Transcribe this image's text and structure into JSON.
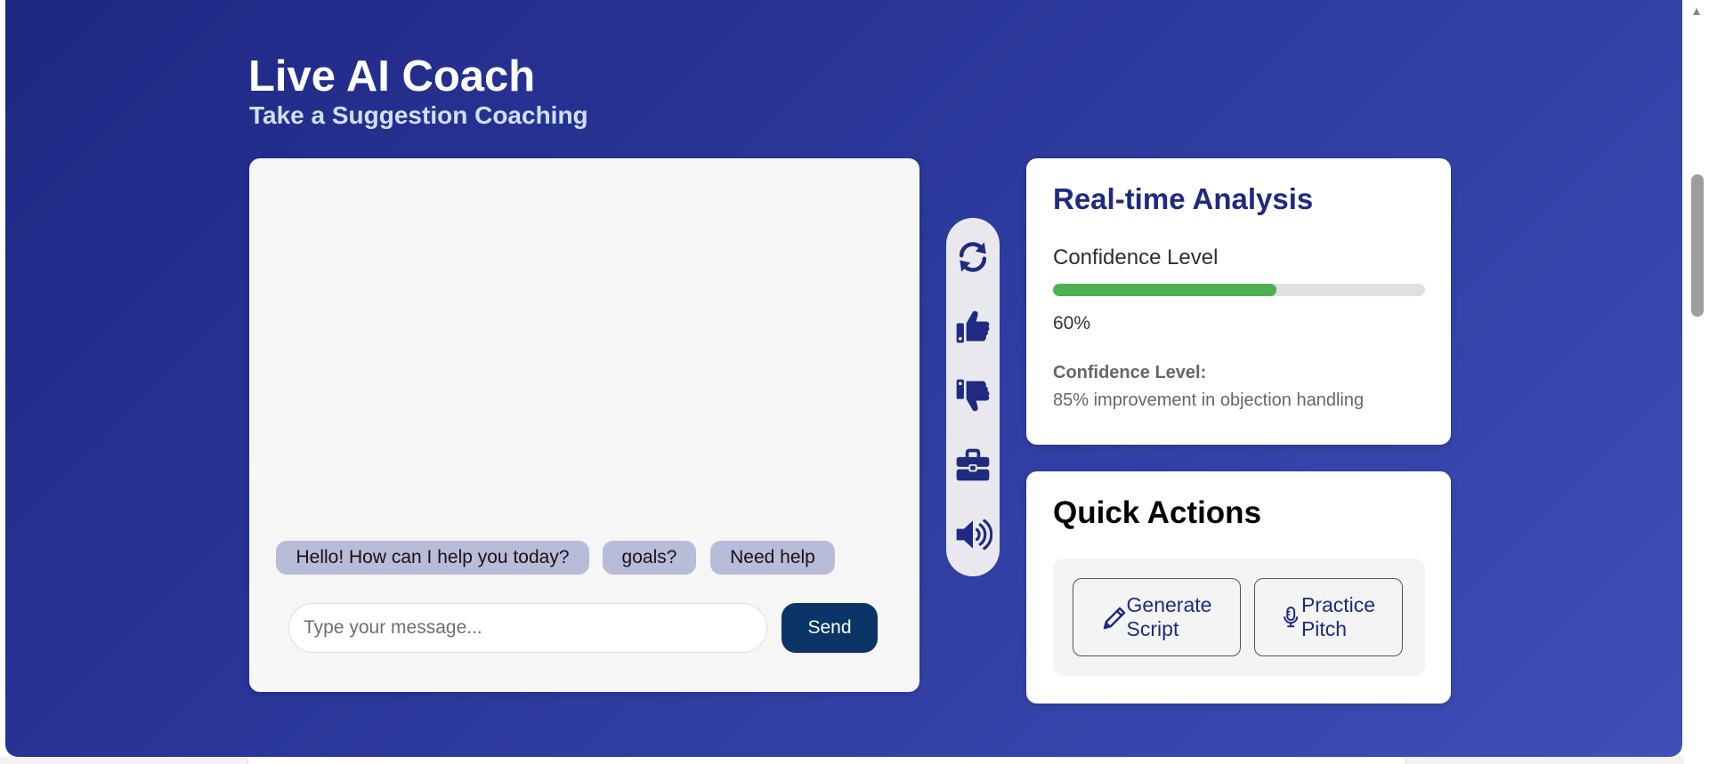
{
  "header": {
    "title": "Live AI Coach",
    "subtitle": "Take a Suggestion Coaching"
  },
  "chat": {
    "suggestions": [
      "Hello! How can I help you today?",
      "goals?",
      "Need help"
    ],
    "input_placeholder": "Type your message...",
    "input_value": "",
    "send_label": "Send"
  },
  "toolbar": {
    "icons": [
      "refresh-icon",
      "thumbs-up-icon",
      "thumbs-down-icon",
      "briefcase-icon",
      "volume-icon"
    ],
    "icon_color": "#1f2a80"
  },
  "analysis": {
    "title": "Real-time Analysis",
    "confidence_label": "Confidence Level",
    "confidence_value": "60%",
    "confidence_fraction": 0.6,
    "insight_label": "Confidence Level:",
    "insight_text": "85% improvement in objection handling"
  },
  "quick_actions": {
    "title": "Quick Actions",
    "buttons": [
      {
        "line1": "Generate",
        "line2": "Script",
        "icon": "pencil-icon"
      },
      {
        "line1": "Practice",
        "line2": "Pitch",
        "icon": "microphone-icon"
      }
    ]
  },
  "colors": {
    "background_start": "#1e2783",
    "background_end": "#3f4fb8",
    "accent": "#1f2a80",
    "send_button": "#0a3566",
    "progress": "#4caf50",
    "chip": "#b7bcd9"
  }
}
